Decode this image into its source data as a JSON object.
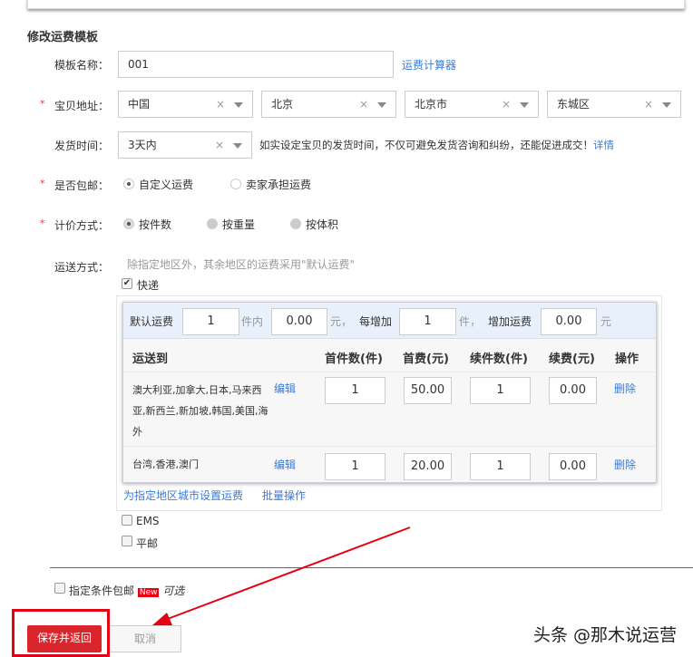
{
  "title": "修改运费模板",
  "template_name": {
    "label": "模板名称：",
    "value": "001",
    "calc_link": "运费计算器"
  },
  "address": {
    "label": "宝贝地址：",
    "required": "*",
    "country": "中国",
    "province": "北京",
    "city": "北京市",
    "district": "东城区",
    "clear": "×"
  },
  "ship_time": {
    "label": "发货时间：",
    "value": "3天内",
    "hint": "如实设定宝贝的发货时间，不仅可避免发货咨询和纠纷，还能促进成交！",
    "detail_link": "详情"
  },
  "free_shipping": {
    "label": "是否包邮：",
    "options": [
      "自定义运费",
      "卖家承担运费"
    ],
    "selected": "自定义运费"
  },
  "pricing": {
    "label": "计价方式：",
    "options": [
      "按件数",
      "按重量",
      "按体积"
    ],
    "selected": "按件数"
  },
  "delivery": {
    "label": "运送方式：",
    "hint": "除指定地区外，其余地区的运费采用\"默认运费\"",
    "express": {
      "label": "快递",
      "checked": true
    },
    "default_row": {
      "label": "默认运费",
      "first_qty": "1",
      "unit1": "件内",
      "first_fee": "0.00",
      "unit2": "元，",
      "add_label": "每增加",
      "add_qty": "1",
      "unit3": "件，",
      "add_fee_label": "增加运费",
      "add_fee": "0.00",
      "unit4": "元"
    },
    "headers": [
      "运送到",
      "首件数(件)",
      "首费(元)",
      "续件数(件)",
      "续费(元)",
      "操作"
    ],
    "rows": [
      {
        "regions": "澳大利亚,加拿大,日本,马来西亚,新西兰,新加坡,韩国,美国,海外",
        "edit": "编辑",
        "first_qty": "1",
        "first_fee": "50.00",
        "add_qty": "1",
        "add_fee": "0.00",
        "delete": "删除"
      },
      {
        "regions": "台湾,香港,澳门",
        "edit": "编辑",
        "first_qty": "1",
        "first_fee": "20.00",
        "add_qty": "1",
        "add_fee": "0.00",
        "delete": "删除"
      }
    ],
    "set_region_link": "为指定地区城市设置运费",
    "batch_link": "批量操作",
    "ems": {
      "label": "EMS",
      "checked": false
    },
    "post": {
      "label": "平邮",
      "checked": false
    }
  },
  "conditional": {
    "label": "指定条件包邮",
    "badge": "New",
    "optional": "可选",
    "checked": false
  },
  "buttons": {
    "save": "保存并返回",
    "cancel": "取消"
  },
  "watermark": "头条 @那木说运营",
  "colors": {
    "accent": "#3a7bd5",
    "save": "#d9262c",
    "highlight": "#e60012",
    "default_row_bg": "#e8f0fb"
  }
}
